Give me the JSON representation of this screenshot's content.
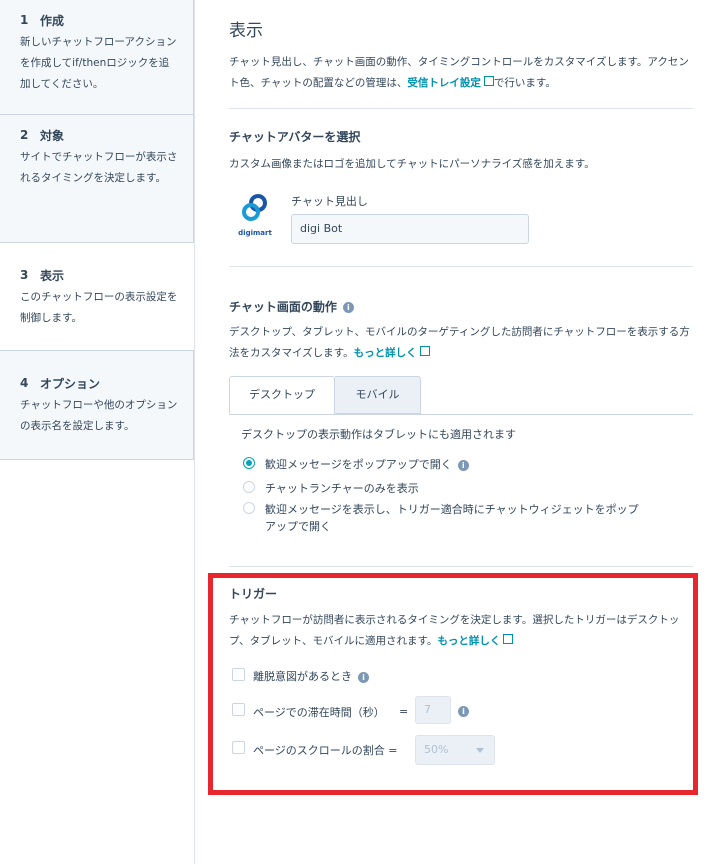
{
  "steps": [
    {
      "num": "1",
      "title": "作成",
      "desc": "新しいチャットフローアクションを作成してif/thenロジックを追加してください。"
    },
    {
      "num": "2",
      "title": "対象",
      "desc": "サイトでチャットフローが表示されるタイミングを決定します。"
    },
    {
      "num": "3",
      "title": "表示",
      "desc": "このチャットフローの表示設定を制御します。"
    },
    {
      "num": "4",
      "title": "オプション",
      "desc": "チャットフローや他のオプションの表示名を設定します。"
    }
  ],
  "main": {
    "title": "表示",
    "intro_line1": "チャット見出し、チャット画面の動作、タイミングコントロールをカスタマイズします。アクセン",
    "intro_line2_pre": "ト色、チャットの配置などの管理は、",
    "intro_link": "受信トレイ設定",
    "intro_line2_post": "で行います。"
  },
  "avatar": {
    "heading": "チャットアバターを選択",
    "desc": "カスタム画像またはロゴを追加してチャットにパーソナライズ感を加えます。",
    "logo_text": "digimart",
    "field_label": "チャット見出し",
    "field_value": "digi Bot"
  },
  "behavior": {
    "heading": "チャット画面の動作",
    "desc_line1": "デスクトップ、タブレット、モバイルのターゲティングした訪問者にチャットフローを表示する方",
    "desc_line2_pre": "法をカスタマイズします。",
    "link": "もっと詳しく",
    "tabs": [
      "デスクトップ",
      "モバイル"
    ],
    "note": "デスクトップの表示動作はタブレットにも適用されます",
    "options": [
      "歓迎メッセージをポップアップで開く",
      "チャットランチャーのみを表示",
      "歓迎メッセージを表示し、トリガー適合時にチャットウィジェットをポップ",
      "アップで開く"
    ]
  },
  "trigger": {
    "heading": "トリガー",
    "desc_line1": "チャットフローが訪問者に表示されるタイミングを決定します。選択したトリガーはデスクトッ",
    "desc_line2_pre": "プ、タブレット、モバイルに適用されます。",
    "link": "もっと詳しく",
    "exit_intent": "離脱意図があるとき",
    "time_on_page": "ページでの滞在時間（秒）",
    "equals": "=",
    "time_value": "7",
    "scroll": "ページのスクロールの割合",
    "scroll_value": "50%"
  },
  "colors": {
    "accent": "#00a4bd",
    "link": "#0091ae",
    "highlight": "#e8262e"
  }
}
